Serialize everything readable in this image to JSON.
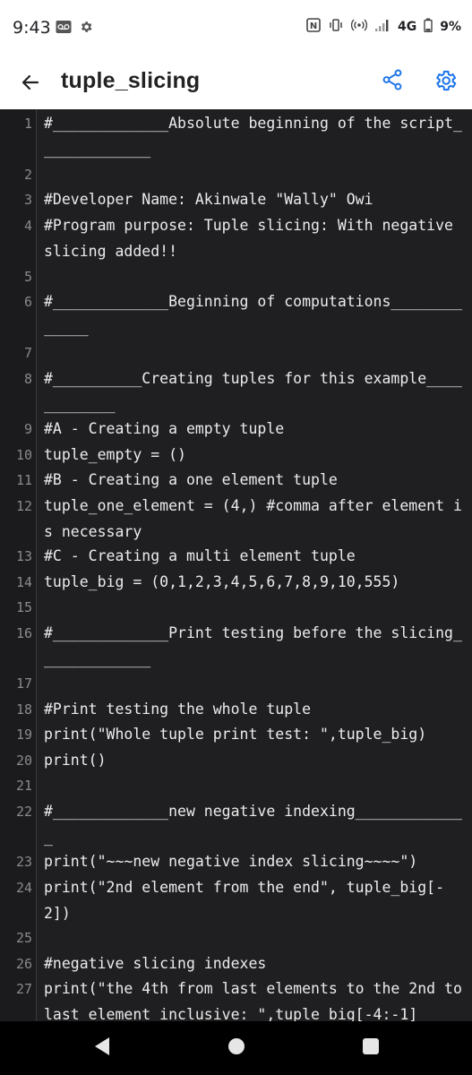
{
  "status_bar": {
    "time": "9:43",
    "left_icons": [
      "voicemail-icon",
      "settings-gear-icon"
    ],
    "right_text": "4G",
    "battery": "9%",
    "right_icons": [
      "nfc-icon",
      "vibrate-icon",
      "hotspot-icon",
      "signal-icon",
      "battery-icon"
    ]
  },
  "app_bar": {
    "title": "tuple_slicing",
    "back_icon": "arrow-left-icon",
    "share_icon": "share-icon",
    "settings_icon": "gear-icon",
    "accent_color": "#1a73e8"
  },
  "editor": {
    "lines": [
      {
        "num": "1",
        "text": "#_____________Absolute beginning of the script_____________"
      },
      {
        "num": "2",
        "text": ""
      },
      {
        "num": "3",
        "text": "#Developer Name: Akinwale \"Wally\" Owi"
      },
      {
        "num": "4",
        "text": "#Program purpose: Tuple slicing: With negative slicing added!!"
      },
      {
        "num": "5",
        "text": ""
      },
      {
        "num": "6",
        "text": "#_____________Beginning of computations_____________"
      },
      {
        "num": "7",
        "text": ""
      },
      {
        "num": "8",
        "text": "#__________Creating tuples for this example____________"
      },
      {
        "num": "9",
        "text": "#A - Creating a empty tuple"
      },
      {
        "num": "10",
        "text": "tuple_empty = ()"
      },
      {
        "num": "11",
        "text": "#B - Creating a one element tuple"
      },
      {
        "num": "12",
        "text": "tuple_one_element = (4,) #comma after element is necessary"
      },
      {
        "num": "13",
        "text": "#C - Creating a multi element tuple"
      },
      {
        "num": "14",
        "text": "tuple_big = (0,1,2,3,4,5,6,7,8,9,10,555)"
      },
      {
        "num": "15",
        "text": ""
      },
      {
        "num": "16",
        "text": "#_____________Print testing before the slicing_____________"
      },
      {
        "num": "17",
        "text": ""
      },
      {
        "num": "18",
        "text": "#Print testing the whole tuple"
      },
      {
        "num": "19",
        "text": "print(\"Whole tuple print test: \",tuple_big)"
      },
      {
        "num": "20",
        "text": "print()"
      },
      {
        "num": "21",
        "text": ""
      },
      {
        "num": "22",
        "text": "#_____________new negative indexing_____________"
      },
      {
        "num": "23",
        "text": "print(\"~~~new negative index slicing~~~~\")"
      },
      {
        "num": "24",
        "text": "print(\"2nd element from the end\", tuple_big[-2])"
      },
      {
        "num": "25",
        "text": ""
      },
      {
        "num": "26",
        "text": "#negative slicing indexes"
      },
      {
        "num": "27",
        "text": "print(\"the 4th from last elements to the 2nd to last element inclusive: \",tuple_big[-4:-1]"
      }
    ]
  },
  "nav_bar": {
    "back_icon": "nav-back-triangle-icon",
    "home_icon": "nav-home-circle-icon",
    "recents_icon": "nav-recents-square-icon"
  }
}
